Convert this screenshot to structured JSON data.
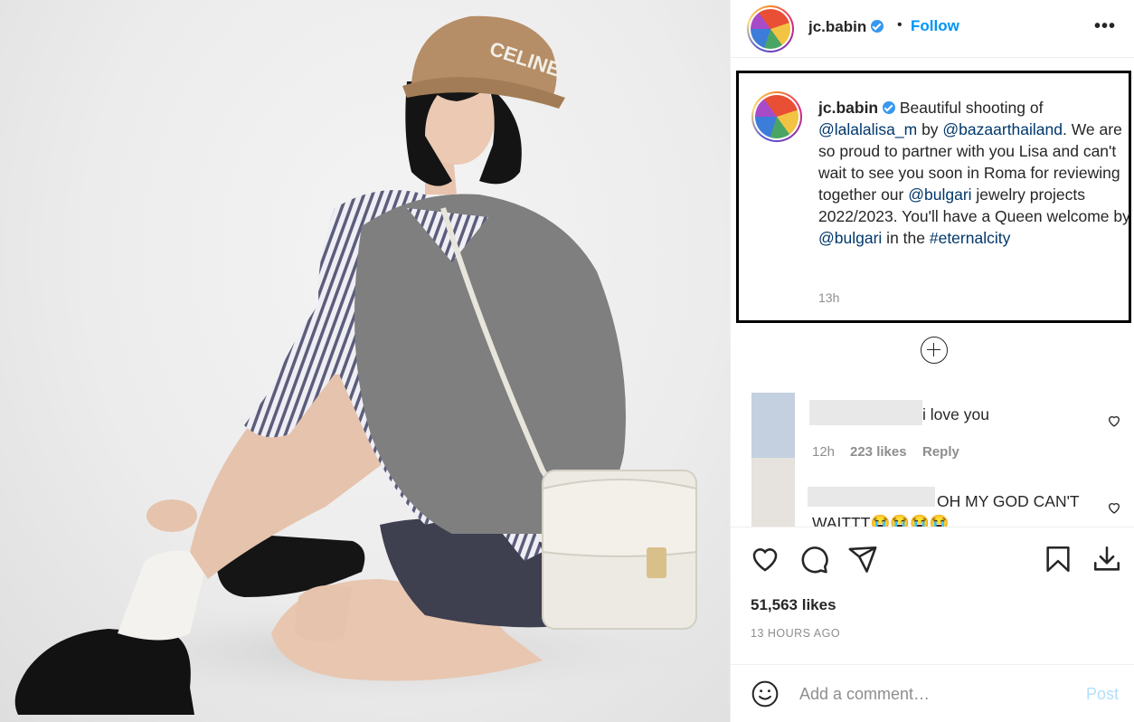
{
  "post": {
    "username": "jc.babin",
    "follow_label": "Follow",
    "separator": "•",
    "more_label": "•••"
  },
  "caption": {
    "username": "jc.babin",
    "segments": [
      {
        "text": " Beautiful shooting of ",
        "type": "text"
      },
      {
        "text": "@lalalalisa_m",
        "type": "mention"
      },
      {
        "text": " by ",
        "type": "text"
      },
      {
        "text": "@bazaarthailand",
        "type": "mention"
      },
      {
        "text": ". We are so proud to partner with you Lisa and can't wait to see you soon in Roma for reviewing together our ",
        "type": "text"
      },
      {
        "text": "@bulgari",
        "type": "mention"
      },
      {
        "text": " jewelry projects 2022/2023. You'll have a Queen welcome by ",
        "type": "text"
      },
      {
        "text": "@bulgari",
        "type": "mention"
      },
      {
        "text": " in the ",
        "type": "text"
      },
      {
        "text": "#eternalcity",
        "type": "mention"
      }
    ],
    "time": "13h"
  },
  "comments": [
    {
      "text": "i love you",
      "time": "12h",
      "likes": "223 likes",
      "reply": "Reply"
    },
    {
      "text": "OH MY GOD CAN'T",
      "text2": "WAITTT😭😭😭😭"
    }
  ],
  "actions": {
    "likes": "51,563 likes",
    "posted": "13 HOURS AGO",
    "icons": [
      "heart-icon",
      "comment-icon",
      "share-icon",
      "bookmark-icon",
      "download-icon"
    ]
  },
  "add_comment": {
    "placeholder": "Add a comment…",
    "post_label": "Post"
  },
  "colors": {
    "accent": "#0095f6",
    "mention": "#00376b",
    "muted": "#8e8e8e",
    "post_disabled": "#b2dffc"
  }
}
